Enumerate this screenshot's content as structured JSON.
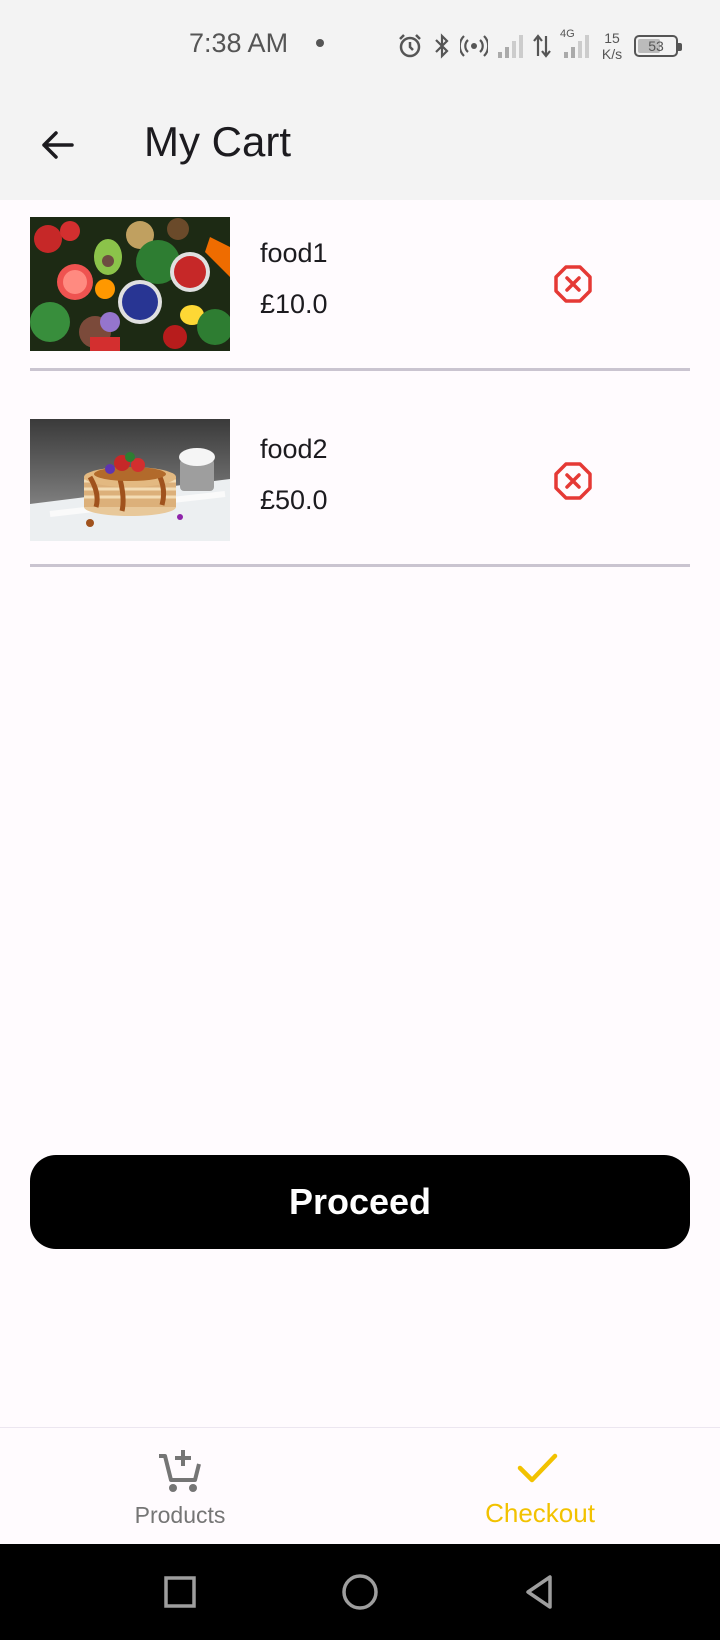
{
  "status_bar": {
    "time": "7:38 AM",
    "network_speed_value": "15",
    "network_speed_unit": "K/s",
    "network_type": "4G",
    "battery_level": "53",
    "icons": [
      "alarm-icon",
      "bluetooth-icon",
      "hotspot-icon",
      "signal-icon",
      "data-transfer-icon",
      "signal-4g-icon",
      "battery-icon"
    ]
  },
  "app_bar": {
    "title": "My Cart",
    "back_icon": "arrow-left-icon"
  },
  "cart": {
    "items": [
      {
        "name": "food1",
        "price": "£10.0",
        "image": "vegetables-photo",
        "remove_icon": "close-circle-icon"
      },
      {
        "name": "food2",
        "price": "£50.0",
        "image": "pancakes-photo",
        "remove_icon": "close-circle-icon"
      }
    ]
  },
  "actions": {
    "proceed_label": "Proceed"
  },
  "bottom_nav": {
    "items": [
      {
        "label": "Products",
        "icon": "cart-add-icon",
        "active": false
      },
      {
        "label": "Checkout",
        "icon": "check-icon",
        "active": true
      }
    ]
  },
  "colors": {
    "accent": "#f2c200",
    "danger": "#e53935",
    "app_bar_bg": "#f3f3f3",
    "page_bg": "#fffbfe",
    "button_bg": "#000000"
  }
}
